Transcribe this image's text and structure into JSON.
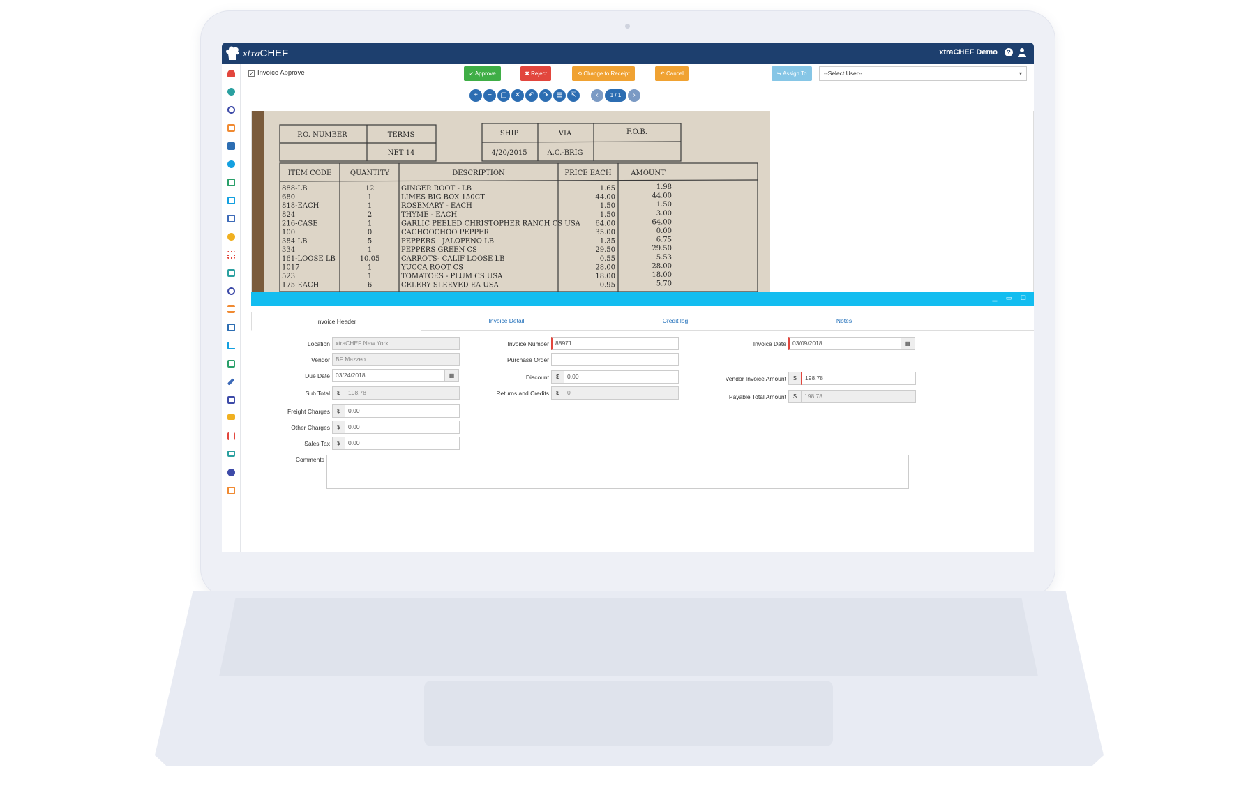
{
  "app": {
    "logo_prefix": "xtra",
    "logo_suffix": "CHEF",
    "user_name": "xtraCHEF Demo"
  },
  "toolbar": {
    "checkbox_label": "Invoice Approve",
    "approve": "✓ Approve",
    "reject": "✖ Reject",
    "change_to_receipt": "⟲ Change to Receipt",
    "cancel": "↶ Cancel",
    "assign_to": "↪ Assign To",
    "select_user": "--Select User--"
  },
  "viewer": {
    "tools": [
      "+",
      "−",
      "▢",
      "✕",
      "↶",
      "↷",
      "▤",
      "⇱"
    ],
    "page_indicator": "1 / 1",
    "document": {
      "header_top": [
        "P.O. NUMBER",
        "TERMS",
        "SHIP",
        "VIA",
        "F.O.B."
      ],
      "header_values": [
        "NET 14",
        "4/20/2015",
        "A.C.-BRIG"
      ],
      "columns": [
        "ITEM CODE",
        "QUANTITY",
        "DESCRIPTION",
        "PRICE EACH",
        "AMOUNT"
      ],
      "rows": [
        [
          "888-LB",
          "12",
          "GINGER ROOT - LB",
          "1.65",
          "1.98"
        ],
        [
          "680",
          "1",
          "LIMES BIG BOX 150CT",
          "44.00",
          "44.00"
        ],
        [
          "818-EACH",
          "1",
          "ROSEMARY - EACH",
          "1.50",
          "1.50"
        ],
        [
          "824",
          "2",
          "THYME - EACH",
          "1.50",
          "3.00"
        ],
        [
          "216-CASE",
          "1",
          "GARLIC PEELED CHRISTOPHER RANCH CS USA",
          "64.00",
          "64.00"
        ],
        [
          "100",
          "0",
          "CACHOOCHOO PEPPER",
          "35.00",
          "0.00"
        ],
        [
          "384-LB",
          "5",
          "PEPPERS - JALOPENO LB",
          "1.35",
          "6.75"
        ],
        [
          "334",
          "1",
          "PEPPERS GREEN CS",
          "29.50",
          "29.50"
        ],
        [
          "161-LOOSE LB",
          "10.05",
          "CARROTS- CALIF LOOSE LB",
          "0.55",
          "5.53"
        ],
        [
          "1017",
          "1",
          "YUCCA ROOT CS",
          "28.00",
          "28.00"
        ],
        [
          "523",
          "1",
          "TOMATOES - PLUM CS USA",
          "18.00",
          "18.00"
        ],
        [
          "175-EACH",
          "6",
          "CELERY SLEEVED   EA USA",
          "0.95",
          "5.70"
        ]
      ]
    }
  },
  "tabs": [
    "Invoice Header",
    "Invoice Detail",
    "Credit log",
    "Notes"
  ],
  "form": {
    "location_label": "Location",
    "location_value": "xtraCHEF New York",
    "vendor_label": "Vendor",
    "vendor_value": "BF Mazzeo",
    "due_date_label": "Due Date",
    "due_date_value": "03/24/2018",
    "sub_total_label": "Sub Total",
    "sub_total_value": "198.78",
    "freight_label": "Freight Charges",
    "freight_value": "0.00",
    "other_label": "Other Charges",
    "other_value": "0.00",
    "sales_tax_label": "Sales Tax",
    "sales_tax_value": "0.00",
    "comments_label": "Comments",
    "invoice_number_label": "Invoice Number",
    "invoice_number_value": "88971",
    "purchase_order_label": "Purchase Order",
    "purchase_order_value": "",
    "discount_label": "Discount",
    "discount_value": "0.00",
    "returns_label": "Returns and Credits",
    "returns_value": "0",
    "invoice_date_label": "Invoice Date",
    "invoice_date_value": "03/09/2018",
    "vendor_amount_label": "Vendor Invoice Amount",
    "vendor_amount_value": "198.78",
    "payable_label": "Payable Total Amount",
    "payable_value": "198.78",
    "currency": "$"
  },
  "colors": {
    "topbar": "#1d3f6e",
    "approve": "#3fae46",
    "reject": "#e2463d",
    "warning": "#f0a232",
    "viewer_bar": "#13bdf0",
    "link": "#1a6bb8"
  },
  "sidebar_icons": [
    "dashboard-icon",
    "user-icon",
    "compass-icon",
    "document-icon",
    "upload-icon",
    "settings-icon",
    "money-icon",
    "table-icon",
    "map-icon",
    "coin-icon",
    "grid-icon",
    "checklist-icon",
    "search-icon",
    "scale-icon",
    "report-icon",
    "chart-icon",
    "calculator-icon",
    "wrench-icon",
    "invoice-icon",
    "card-icon",
    "restaurant-icon",
    "monitor-icon",
    "pie-icon",
    "file-icon"
  ]
}
